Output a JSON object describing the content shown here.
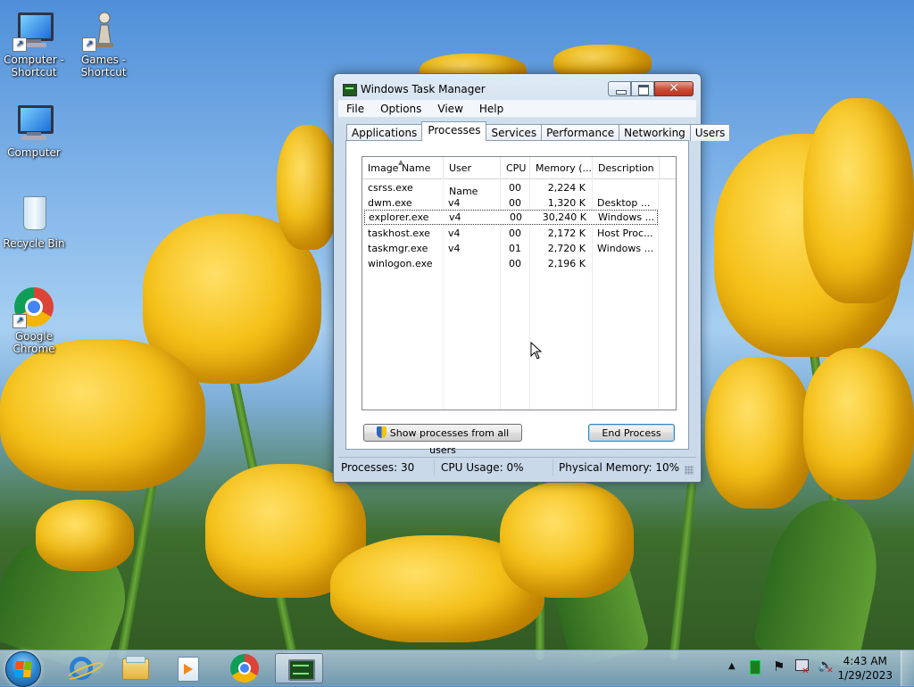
{
  "desktop": {
    "icons": [
      {
        "label_line1": "Computer -",
        "label_line2": "Shortcut"
      },
      {
        "label_line1": "Games -",
        "label_line2": "Shortcut"
      },
      {
        "label_line1": "Computer",
        "label_line2": ""
      },
      {
        "label_line1": "Recycle Bin",
        "label_line2": ""
      },
      {
        "label_line1": "Google",
        "label_line2": "Chrome"
      }
    ]
  },
  "window": {
    "title": "Windows Task Manager",
    "menu": [
      "File",
      "Options",
      "View",
      "Help"
    ],
    "tabs": [
      "Applications",
      "Processes",
      "Services",
      "Performance",
      "Networking",
      "Users"
    ],
    "active_tab": "Processes",
    "columns": [
      "Image Name",
      "User Name",
      "CPU",
      "Memory (...",
      "Description"
    ],
    "processes": [
      {
        "image": "csrss.exe",
        "user": "",
        "cpu": "00",
        "memory": "2,224 K",
        "description": ""
      },
      {
        "image": "dwm.exe",
        "user": "v4",
        "cpu": "00",
        "memory": "1,320 K",
        "description": "Desktop ..."
      },
      {
        "image": "explorer.exe",
        "user": "v4",
        "cpu": "00",
        "memory": "30,240 K",
        "description": "Windows ..."
      },
      {
        "image": "taskhost.exe",
        "user": "v4",
        "cpu": "00",
        "memory": "2,172 K",
        "description": "Host Proc..."
      },
      {
        "image": "taskmgr.exe",
        "user": "v4",
        "cpu": "01",
        "memory": "2,720 K",
        "description": "Windows ..."
      },
      {
        "image": "winlogon.exe",
        "user": "",
        "cpu": "00",
        "memory": "2,196 K",
        "description": ""
      }
    ],
    "selected_process": "explorer.exe",
    "show_all_label": "Show processes from all users",
    "end_process_label": "End Process",
    "status": {
      "processes": "Processes: 30",
      "cpu": "CPU Usage: 0%",
      "memory": "Physical Memory: 10%"
    }
  },
  "taskbar": {
    "apps": [
      "internet-explorer",
      "windows-explorer",
      "media-player",
      "google-chrome",
      "task-manager"
    ],
    "active_app": "task-manager",
    "clock_time": "4:43 AM",
    "clock_date": "1/29/2023"
  },
  "colors": {
    "window_frame": "#c9d9ea",
    "selection_border": "#333333",
    "taskbar": "#87a8c4"
  }
}
